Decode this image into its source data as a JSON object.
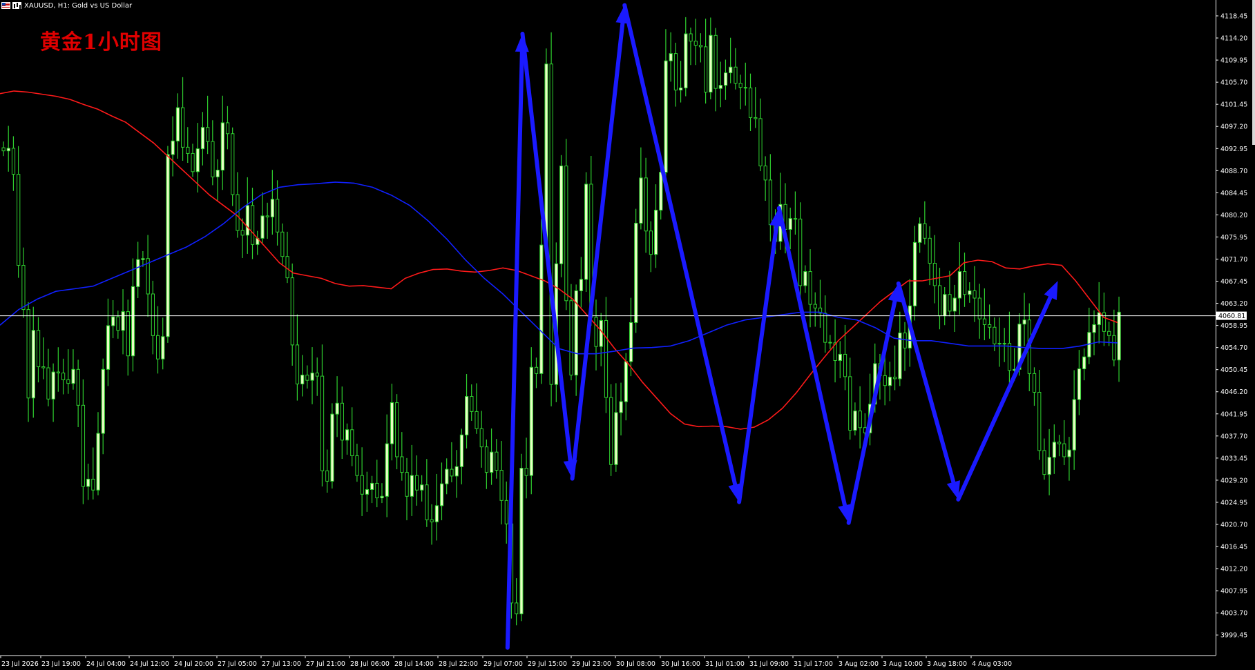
{
  "header": {
    "symbol_line": "XAUUSD, H1:  Gold vs US Dollar"
  },
  "overlay_title": "黄金1小时图",
  "colors": {
    "background": "#000000",
    "candle": "#2fd12f",
    "candle_body_bull": "#e9ffc4",
    "ma_fast": "#ff1a1a",
    "ma_slow": "#1020ff",
    "arrow": "#1a1aff",
    "price_line": "#ffffff",
    "axis_text": "#ffffff"
  },
  "chart_data": {
    "type": "candlestick",
    "symbol": "XAUUSD",
    "timeframe": "H1",
    "current_price": "4060.81",
    "ylim": [
      3995.5,
      4121.5
    ],
    "y_ticks": [
      "4118.45",
      "4114.20",
      "4109.95",
      "4105.70",
      "4101.45",
      "4097.20",
      "4092.95",
      "4088.70",
      "4084.45",
      "4080.20",
      "4075.95",
      "4071.70",
      "4067.45",
      "4063.20",
      "4058.95",
      "4054.70",
      "4050.45",
      "4046.20",
      "4041.95",
      "4037.70",
      "4033.45",
      "4029.20",
      "4024.95",
      "4020.70",
      "4016.45",
      "4012.20",
      "4007.95",
      "4003.70",
      "3999.45"
    ],
    "x_ticks": [
      "23 Jul 2026",
      "23 Jul 19:00",
      "24 Jul 04:00",
      "24 Jul 12:00",
      "24 Jul 20:00",
      "27 Jul 05:00",
      "27 Jul 13:00",
      "27 Jul 21:00",
      "28 Jul 06:00",
      "28 Jul 14:00",
      "28 Jul 22:00",
      "29 Jul 07:00",
      "29 Jul 15:00",
      "29 Jul 23:00",
      "30 Jul 08:00",
      "30 Jul 16:00",
      "31 Jul 01:00",
      "31 Jul 09:00",
      "31 Jul 17:00",
      "3 Aug 02:00",
      "3 Aug 10:00",
      "3 Aug 18:00",
      "4 Aug 03:00"
    ],
    "closes": [
      4092.5,
      4093.0,
      4088.0,
      4070.5,
      4062.0,
      4045.0,
      4058.0,
      4051.0,
      4050.8,
      4044.8,
      4050.0,
      4049.8,
      4048.5,
      4047.8,
      4050.5,
      4043.6,
      4028.0,
      4029.4,
      4027.3,
      4038.2,
      4050.5,
      4058.9,
      4060.6,
      4058.0,
      4061.6,
      4053.1,
      4066.4,
      4071.6,
      4071.8,
      4065.0,
      4057.0,
      4052.5,
      4056.8,
      4091.8,
      4094.4,
      4100.8,
      4093.2,
      4092.0,
      4088.5,
      4092.9,
      4097.0,
      4094.3,
      4087.5,
      4088.8,
      4097.9,
      4095.8,
      4084.1,
      4077.2,
      4076.3,
      4082.0,
      4074.5,
      4075.7,
      4080.0,
      4079.8,
      4083.2,
      4076.9,
      4072.2,
      4068.1,
      4055.2,
      4047.7,
      4049.4,
      4048.4,
      4049.8,
      4049.2,
      4031.0,
      4029.0,
      4041.9,
      4044.0,
      4036.9,
      4038.9,
      4033.9,
      4030.1,
      4026.5,
      4027.4,
      4028.6,
      4025.8,
      4026.1,
      4036.2,
      4044.1,
      4033.7,
      4030.7,
      4026.1,
      4030.1,
      4027.3,
      4028.3,
      4021.6,
      4021.2,
      4024.3,
      4028.5,
      4031.3,
      4030.0,
      4031.8,
      4037.9,
      4045.3,
      4042.4,
      4039.1,
      4035.6,
      4030.7,
      4034.6,
      4031.1,
      4025.3,
      4020.8,
      4005.6,
      4003.5,
      4031.5,
      4030.1,
      4050.9,
      4049.7,
      4074.4,
      4109.2,
      4047.6,
      4070.8,
      4089.6,
      4063.7,
      4049.4,
      4065.6,
      4067.8,
      4086.1,
      4060.5,
      4054.9,
      4059.9,
      4045.1,
      4032.2,
      4042.2,
      4044.3,
      4052.0,
      4059.5,
      4078.6,
      4087.3,
      4077.1,
      4072.6,
      4081.1,
      4088.4,
      4109.8,
      4111.2,
      4104.2,
      4104.6,
      4115.0,
      4113.6,
      4112.8,
      4112.5,
      4103.8,
      4114.7,
      4104.5,
      4105.1,
      4107.5,
      4108.6,
      4105.5,
      4104.7,
      4104.6,
      4098.9,
      4098.7,
      4089.6,
      4086.9,
      4078.3,
      4075.1,
      4082.2,
      4077.4,
      4079.5,
      4079.4,
      4066.6,
      4069.3,
      4063.0,
      4062.3,
      4061.3,
      4055.7,
      4055.6,
      4052.2,
      4053.4,
      4049.1,
      4038.8,
      4042.5,
      4039.3,
      4038.3,
      4043.8,
      4051.6,
      4049.3,
      4047.4,
      4049.0,
      4048.7,
      4057.5,
      4054.6,
      4062.7,
      4074.9,
      4078.5,
      4075.7,
      4070.9,
      4066.6,
      4060.8,
      4064.9,
      4061.7,
      4064.2,
      4069.3,
      4064.9,
      4065.6,
      4064.2,
      4060.2,
      4059.1,
      4058.6,
      4055.4,
      4055.5,
      4055.5,
      4050.3,
      4050.5,
      4059.2,
      4060.0,
      4049.7,
      4046.1,
      4034.9,
      4030.3,
      4033.6,
      4036.5,
      4036.2,
      4033.7,
      4035.0,
      4044.7,
      4050.6,
      4052.9,
      4057.6,
      4059.1,
      4061.4,
      4057.8,
      4057.0,
      4052.3,
      4061.5
    ],
    "series": [
      {
        "name": "MA red",
        "values": [
          4103.5,
          4104.0,
          4103.8,
          4103.4,
          4103.0,
          4102.4,
          4101.4,
          4100.5,
          4099.2,
          4098.0,
          4096.0,
          4094.0,
          4091.5,
          4089.0,
          4086.5,
          4084.0,
          4082.0,
          4080.0,
          4077.0,
          4074.0,
          4071.0,
          4069.0,
          4068.5,
          4068.0,
          4067.0,
          4066.5,
          4066.6,
          4066.3,
          4066.0,
          4068.0,
          4069.0,
          4069.7,
          4069.8,
          4069.4,
          4069.2,
          4069.5,
          4070.0,
          4069.5,
          4068.5,
          4067.5,
          4066.0,
          4064.0,
          4061.0,
          4058.0,
          4054.5,
          4051.5,
          4048.0,
          4045.0,
          4042.0,
          4040.0,
          4039.5,
          4039.6,
          4039.5,
          4039.0,
          4039.4,
          4040.8,
          4043.0,
          4046.0,
          4049.5,
          4052.8,
          4056.0,
          4058.5,
          4061.0,
          4063.5,
          4065.5,
          4067.5,
          4067.5,
          4068.0,
          4068.5,
          4071.0,
          4071.5,
          4071.2,
          4070.0,
          4069.8,
          4070.4,
          4070.8,
          4070.5,
          4067.5,
          4064.0,
          4060.5,
          4059.5
        ]
      },
      {
        "name": "MA blue",
        "values": [
          4059.0,
          4062.0,
          4064.0,
          4065.5,
          4066.0,
          4066.5,
          4068.0,
          4069.5,
          4071.0,
          4072.5,
          4074.0,
          4076.0,
          4078.5,
          4081.5,
          4084.0,
          4085.5,
          4086.0,
          4086.2,
          4086.5,
          4086.3,
          4085.5,
          4084.0,
          4082.0,
          4079.0,
          4075.5,
          4071.5,
          4068.0,
          4065.0,
          4061.5,
          4058.0,
          4054.5,
          4053.5,
          4053.5,
          4054.0,
          4054.6,
          4054.7,
          4055.0,
          4056.0,
          4057.5,
          4059.0,
          4060.0,
          4060.5,
          4061.0,
          4061.5,
          4061.5,
          4060.5,
          4060.0,
          4058.5,
          4056.5,
          4056.0,
          4056.0,
          4055.5,
          4055.0,
          4055.0,
          4055.0,
          4054.7,
          4054.5,
          4054.5,
          4055.0,
          4055.8,
          4055.6
        ]
      }
    ],
    "annotations": [
      {
        "type": "arrow-path",
        "points": [
          [
            101.5,
            3997.0
          ],
          [
            104.5,
            4115.0
          ],
          [
            114.5,
            4029.5
          ],
          [
            125,
            4120.5
          ],
          [
            148,
            4025
          ],
          [
            156,
            4081.5
          ],
          [
            170,
            4021
          ],
          [
            180,
            4067
          ],
          [
            192,
            4025.5
          ],
          [
            212,
            4067.5
          ]
        ]
      }
    ]
  }
}
